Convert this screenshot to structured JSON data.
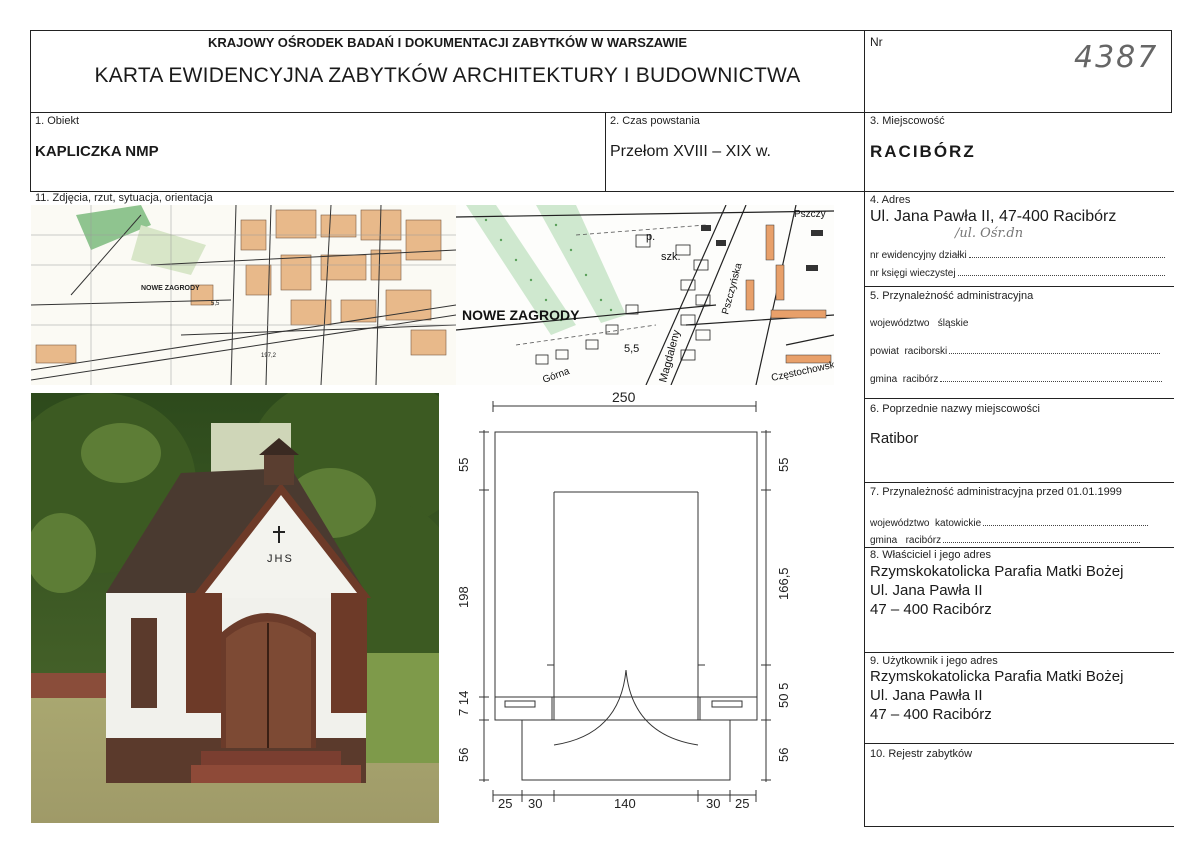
{
  "header": {
    "institution": "KRAJOWY OŚRODEK BADAŃ I DOKUMENTACJI ZABYTKÓW W WARSZAWIE",
    "title": "KARTA EWIDENCYJNA ZABYTKÓW ARCHITEKTURY I BUDOWNICTWA",
    "nr_label": "Nr",
    "nr_value": "4387"
  },
  "obiekt": {
    "label": "1. Obiekt",
    "value": "KAPLICZKA NMP"
  },
  "czas": {
    "label": "2. Czas powstania",
    "value": "Przełom XVIII – XIX w."
  },
  "miejscowosc": {
    "label": "3. Miejscowość",
    "value": "RACIBÓRZ"
  },
  "zdjecia": {
    "label": "11. Zdjęcia, rzut, sytuacja, orientacja"
  },
  "adres": {
    "label": "4. Adres",
    "value": "Ul. Jana Pawła II, 47-400 Racibórz",
    "handwritten": "/ul. Ośr.dn",
    "dzialka_label": "nr ewidencyjny działki",
    "ksiega_label": "nr księgi wieczystej"
  },
  "przynaleznosc": {
    "label": "5. Przynależność administracyjna",
    "wojewodztwo": "województwo   śląskie",
    "powiat": "powiat  raciborski",
    "gmina": "gmina  racibórz"
  },
  "poprzednie": {
    "label": "6. Poprzednie nazwy miejscowości",
    "value": "Ratibor"
  },
  "przynaleznosc_przed": {
    "label": "7. Przynależność administracyjna przed 01.01.1999",
    "wojewodztwo": "województwo  katowickie",
    "gmina": "gmina   racibórz"
  },
  "wlasciciel": {
    "label": "8. Właściciel i jego adres",
    "lines": [
      "Rzymskokatolicka Parafia Matki Bożej",
      "Ul. Jana Pawła II",
      "47 – 400 Racibórz"
    ]
  },
  "uzytkownik": {
    "label": "9. Użytkownik i jego adres",
    "lines": [
      "Rzymskokatolicka Parafia Matki Bożej",
      "Ul. Jana Pawła II",
      "47 – 400 Racibórz"
    ]
  },
  "rejestr": {
    "label": "10. Rejestr zabytków"
  },
  "map": {
    "place_large": "NOWE ZAGRODY",
    "place_small": "NOWE ZAGRODY",
    "street_1": "Pszczyńska",
    "street_2": "Magdaleny",
    "street_3": "Górna",
    "street_4": "Częstochowska",
    "street_5": "Pszczy",
    "label_szk": "szk.",
    "label_p": "p.",
    "height_1": "5,5",
    "height_2": "5,5",
    "height_3": "197,2"
  },
  "photo": {
    "inscription": "JHS"
  },
  "plan": {
    "top_width": "250",
    "left_top": "55",
    "left_mid": "198",
    "left_low": "7 14",
    "left_bottom": "56",
    "right_top": "55",
    "right_mid": "166,5",
    "right_low": "50 5",
    "right_bottom": "56",
    "bottom": [
      "25",
      "30",
      "140",
      "30",
      "25"
    ]
  }
}
